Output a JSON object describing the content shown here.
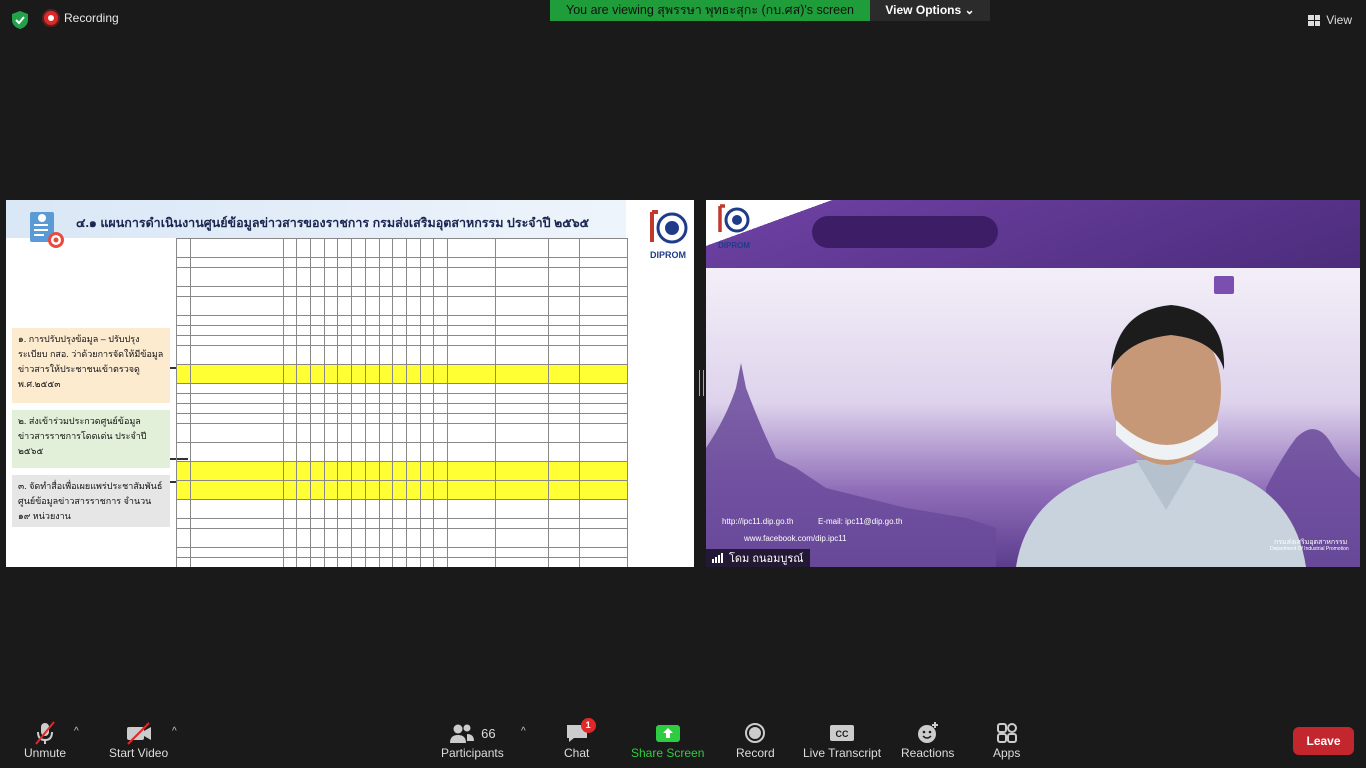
{
  "topbar": {
    "recording_label": "Recording",
    "viewing_banner": "You are viewing สุพรรษา พุทธะสุกะ (กบ.ศส)'s screen",
    "view_options_label": "View Options",
    "view_label": "View"
  },
  "shared_slide": {
    "title": "๔.๑ แผนการดำเนินงานศูนย์ข้อมูลข่าวสารของราชการ กรมส่งเสริมอุตสาหกรรม ประจำปี ๒๕๖๕",
    "logo_text": "DIPROM",
    "side_boxes": [
      "๑. การปรับปรุงข้อมูล – ปรับปรุงระเบียบ กสอ. ว่าด้วยการจัดให้มีข้อมูลข่าวสารให้ประชาชนเข้าตรวจดู พ.ศ.๒๕๕๓",
      "๒. ส่งเข้าร่วมประกวดศูนย์ข้อมูลข่าวสารราชการโดดเด่น ประจำปี ๒๕๖๕",
      "๓. จัดทำสื่อเพื่อเผยแพร่ประชาสัมพันธ์ศูนย์ข้อมูลข่าวสารราชการ จำนวน ๑๙ หน่วยงาน"
    ]
  },
  "camera": {
    "participant_name": "โดม ถนอมบูรณ์",
    "logo_text": "DIPROM",
    "url_text": "http://ipc11.dip.go.th",
    "email_text": "E-mail: ipc11@dip.go.th",
    "facebook_text": "www.facebook.com/dip.ipc11",
    "dept_th": "กรมส่งเสริมอุตสาหกรรม",
    "dept_en": "Department Of Industrial Promotion"
  },
  "toolbar": {
    "unmute": "Unmute",
    "start_video": "Start Video",
    "participants": "Participants",
    "participants_count": "66",
    "chat": "Chat",
    "chat_badge": "1",
    "share_screen": "Share Screen",
    "record": "Record",
    "live_transcript": "Live Transcript",
    "reactions": "Reactions",
    "apps": "Apps",
    "leave": "Leave"
  },
  "colors": {
    "share_green": "#2ecc40",
    "leave_red": "#c4262e",
    "banner_green": "#1f9d3a",
    "badge_red": "#e02828"
  }
}
